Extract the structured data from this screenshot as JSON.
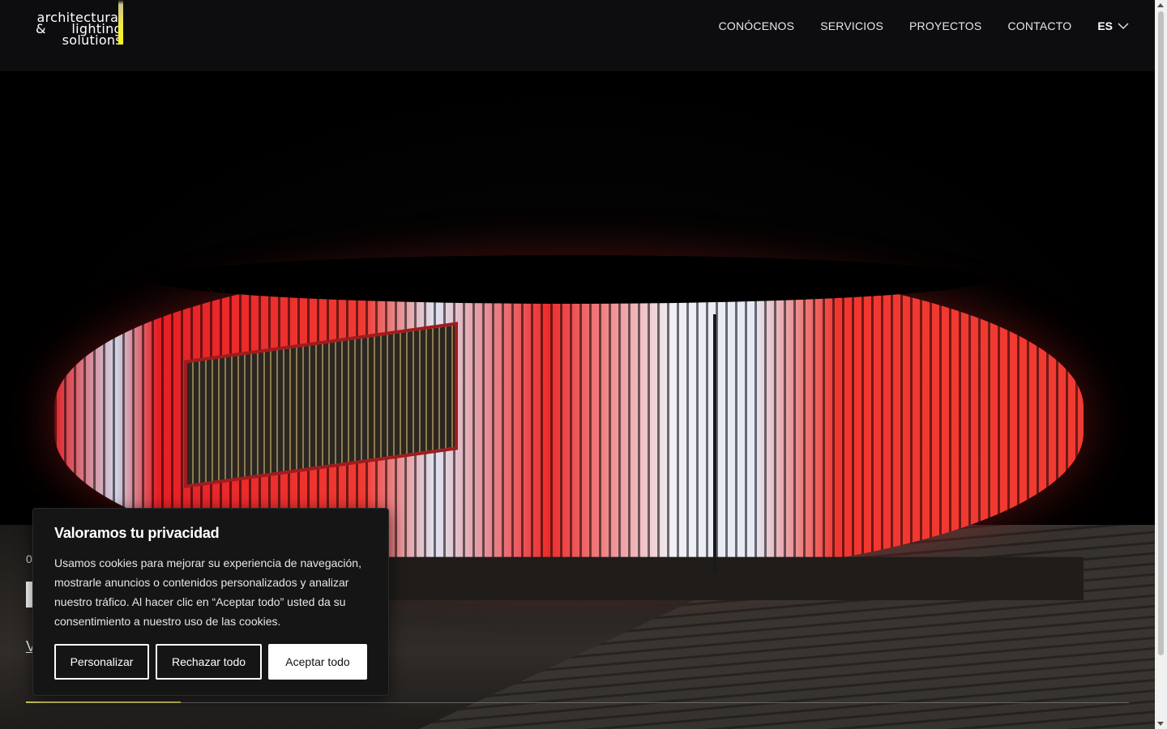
{
  "header": {
    "logo": {
      "line1": "architectural",
      "line2_amp": "&",
      "line2": "lighting",
      "line3": "solutions"
    },
    "nav": [
      "CONÓCENOS",
      "SERVICIOS",
      "PROYECTOS",
      "CONTACTO"
    ],
    "language": "ES",
    "accent_color": "#f3ee3a"
  },
  "hero": {
    "label_partial": "0",
    "link_partial": "V",
    "slide_progress_fraction": 0.14
  },
  "cookie_banner": {
    "title": "Valoramos tu privacidad",
    "body": "Usamos cookies para mejorar su experiencia de navegación, mostrarle anuncios o contenidos personalizados y analizar nuestro tráfico. Al hacer clic en “Aceptar todo” usted da su consentimiento a nuestro uso de las cookies.",
    "buttons": {
      "customize": "Personalizar",
      "reject": "Rechazar todo",
      "accept": "Aceptar todo"
    }
  }
}
